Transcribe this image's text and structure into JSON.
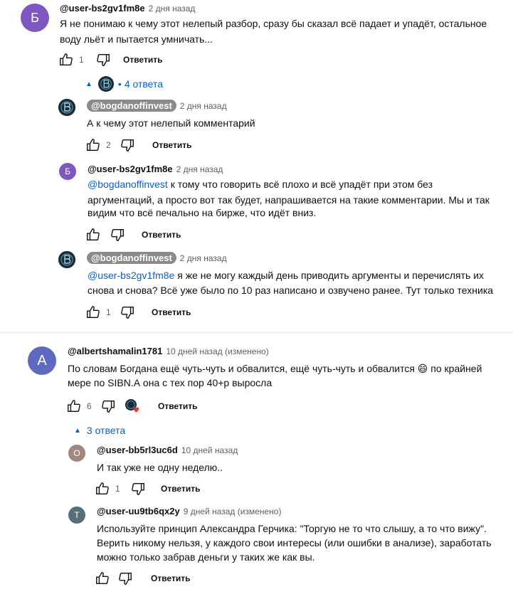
{
  "comments": {
    "c1": {
      "avatar_letter": "Б",
      "avatar_color": "#7e57c2",
      "author": "@user-bs2gv1fm8e",
      "time": "2 дня назад",
      "text_line1": "Я не понимаю к чему этот нелепый разбор, сразу бы сказал всё падает и упадёт, остальное",
      "text_line2": "воду льёт и пытается умничать...",
      "likes": "1",
      "reply_label": "Ответить",
      "replies_toggle": "4 ответа",
      "replies": {
        "r1": {
          "author": "@bogdanoffinvest",
          "time": "2 дня назад",
          "text": "А к чему этот нелепый комментарий",
          "likes": "2",
          "reply_label": "Ответить"
        },
        "r2": {
          "avatar_letter": "Б",
          "avatar_color": "#7e57c2",
          "author": "@user-bs2gv1fm8e",
          "time": "2 дня назад",
          "mention": "@bogdanoffinvest",
          "text_line1_rest": " к тому что говорить всё плохо и всё упадёт при этом без",
          "text_line2": "аргументаций, а просто вот так будет, напрашивается на такие комментарии. Мы и так",
          "text_line3": "видим что всё печально на бирже, что идёт вниз.",
          "reply_label": "Ответить"
        },
        "r3": {
          "author": "@bogdanoffinvest",
          "time": "2 дня назад",
          "mention": "@user-bs2gv1fm8e",
          "text_line1_rest": " я же не могу каждый день приводить аргументы и перечислять их",
          "text_line2": "снова и снова? Всё уже было по 10 раз написано и озвучено ранее. Тут только техника",
          "likes": "1",
          "reply_label": "Ответить"
        }
      }
    },
    "c2": {
      "avatar_letter": "A",
      "avatar_color": "#5c6bc0",
      "author": "@albertshamalin1781",
      "time": "10 дней назад (изменено)",
      "text_line1": "По словам Богдана ещё чуть-чуть и обвалится, ещё чуть-чуть и обвалится",
      "emoji": "😄",
      "text_line1_end": "по крайней",
      "text_line2": "мере по SIBN.А она с тех пор 40+р выросла",
      "likes": "6",
      "reply_label": "Ответить",
      "replies_toggle": "3 ответа",
      "replies": {
        "r1": {
          "avatar_letter": "О",
          "avatar_color": "#a1887f",
          "author": "@user-bb5rl3uc6d",
          "time": "10 дней назад",
          "text": "И так уже не одну неделю..",
          "likes": "1",
          "reply_label": "Ответить"
        },
        "r2": {
          "avatar_letter": "Т",
          "avatar_color": "#546e7a",
          "author": "@user-uu9tb6qx2y",
          "time": "9 дней назад (изменено)",
          "text_line1": "Используйте принцип Александра Герчика: \"Торгую не то что слышу, а то что вижу\".",
          "text_line2": "Верить никому нельзя, у каждого свои интересы (или ошибки в анализе), заработать",
          "text_line3": "можно только забрав деньги у таких же как вы.",
          "reply_label": "Ответить"
        }
      }
    }
  }
}
